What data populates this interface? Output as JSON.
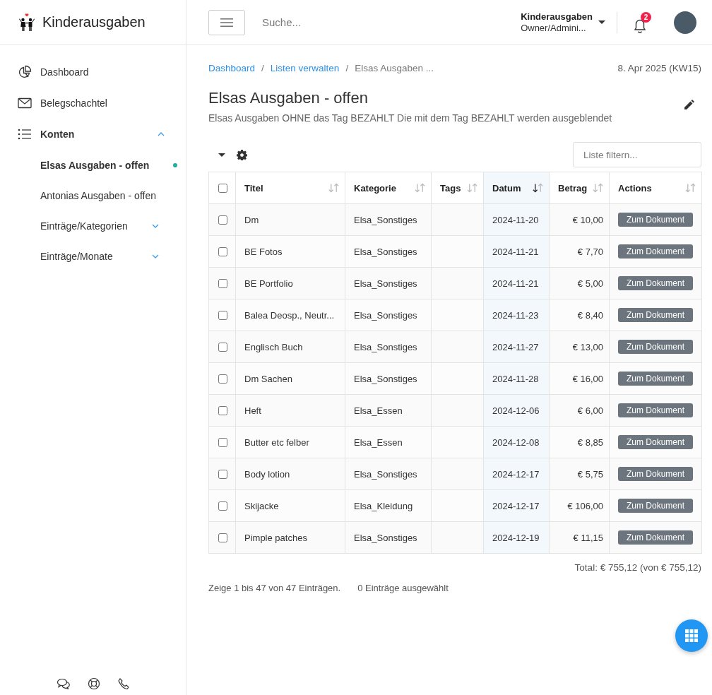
{
  "app": {
    "title": "Kinderausgaben"
  },
  "sidebar": {
    "items": [
      {
        "label": "Dashboard",
        "kind": "link"
      },
      {
        "label": "Belegschachtel",
        "kind": "link"
      },
      {
        "label": "Konten",
        "kind": "group",
        "expanded": true,
        "children": [
          {
            "label": "Elsas Ausgaben - offen",
            "kind": "link",
            "selected": true
          },
          {
            "label": "Antonias Ausgaben - offen",
            "kind": "link",
            "selected": false
          },
          {
            "label": "Einträge/Kategorien",
            "kind": "group",
            "selected": false,
            "expanded": false
          },
          {
            "label": "Einträge/Monate",
            "kind": "group",
            "selected": false,
            "expanded": false
          }
        ]
      }
    ]
  },
  "topbar": {
    "search": {
      "placeholder": "Suche..."
    },
    "account": {
      "name": "Kinderausgaben",
      "role": "Owner/Admini..."
    },
    "notifications": "2"
  },
  "breadcrumb": [
    {
      "kind": "link",
      "label": "Dashboard"
    },
    {
      "kind": "separator",
      "label": "/"
    },
    {
      "kind": "link",
      "label": "Listen verwalten"
    },
    {
      "kind": "separator",
      "label": "/"
    },
    {
      "kind": "current",
      "label": "Elsas Ausgaben ..."
    }
  ],
  "date": "8. Apr 2025 (KW15)",
  "page": {
    "title": "Elsas Ausgaben - offen",
    "description": "Elsas Ausgaben OHNE das Tag BEZAHLT Die mit dem Tag BEZAHLT werden ausgeblendet"
  },
  "filter": {
    "placeholder": "Liste filtern..."
  },
  "table": {
    "all_checked": false,
    "columns": [
      {
        "label": "Titel",
        "sorted": false
      },
      {
        "label": "Kategorie",
        "sorted": false
      },
      {
        "label": "Tags",
        "sorted": false
      },
      {
        "label": "Datum",
        "sorted": true
      },
      {
        "label": "Betrag",
        "sorted": false
      },
      {
        "label": "Actions",
        "sorted": false
      }
    ],
    "rows": [
      {
        "checked": false,
        "title": "Dm",
        "category": "Elsa_Sonstiges",
        "date": "2024-11-20",
        "amount": "€ 10,00",
        "action": "Zum Dokument"
      },
      {
        "checked": false,
        "title": "BE Fotos",
        "category": "Elsa_Sonstiges",
        "date": "2024-11-21",
        "amount": "€ 7,70",
        "action": "Zum Dokument"
      },
      {
        "checked": false,
        "title": "BE Portfolio",
        "category": "Elsa_Sonstiges",
        "date": "2024-11-21",
        "amount": "€ 5,00",
        "action": "Zum Dokument"
      },
      {
        "checked": false,
        "title": "Balea Deosp., Neutr...",
        "category": "Elsa_Sonstiges",
        "date": "2024-11-23",
        "amount": "€ 8,40",
        "action": "Zum Dokument"
      },
      {
        "checked": false,
        "title": "Englisch Buch",
        "category": "Elsa_Sonstiges",
        "date": "2024-11-27",
        "amount": "€ 13,00",
        "action": "Zum Dokument"
      },
      {
        "checked": false,
        "title": "Dm Sachen",
        "category": "Elsa_Sonstiges",
        "date": "2024-11-28",
        "amount": "€ 16,00",
        "action": "Zum Dokument"
      },
      {
        "checked": false,
        "title": "Heft",
        "category": "Elsa_Essen",
        "date": "2024-12-06",
        "amount": "€ 6,00",
        "action": "Zum Dokument"
      },
      {
        "checked": false,
        "title": "Butter etc felber",
        "category": "Elsa_Essen",
        "date": "2024-12-08",
        "amount": "€ 8,85",
        "action": "Zum Dokument"
      },
      {
        "checked": false,
        "title": "Body lotion",
        "category": "Elsa_Sonstiges",
        "date": "2024-12-17",
        "amount": "€ 5,75",
        "action": "Zum Dokument"
      },
      {
        "checked": false,
        "title": "Skijacke",
        "category": "Elsa_Kleidung",
        "date": "2024-12-17",
        "amount": "€ 106,00",
        "action": "Zum Dokument"
      },
      {
        "checked": false,
        "title": "Pimple patches",
        "category": "Elsa_Sonstiges",
        "date": "2024-12-19",
        "amount": "€ 11,15",
        "action": "Zum Dokument"
      }
    ],
    "total": "Total: € 755,12 (von € 755,12)",
    "info": "Zeige 1 bis 47 von 47 Einträgen.",
    "selection": "0 Einträge ausgewählt"
  }
}
